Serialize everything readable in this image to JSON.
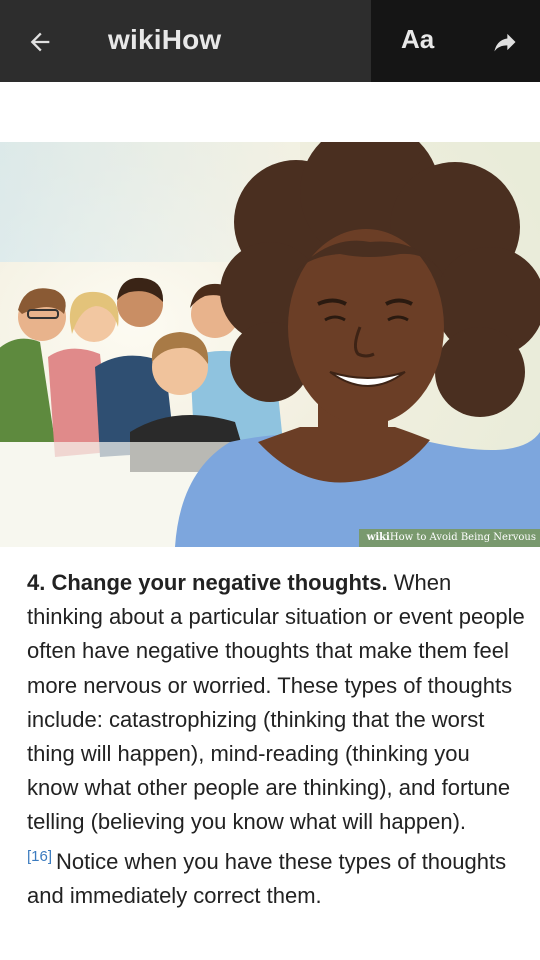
{
  "toolbar": {
    "title": "wikiHow",
    "font_label": "Aa",
    "icons": {
      "back": "arrow-left-icon",
      "share": "share-arrow-icon"
    }
  },
  "image": {
    "watermark_prefix": "wiki",
    "watermark_text": "How to Avoid Being Nervous"
  },
  "article": {
    "step_title": "4. Change your negative thoughts.",
    "text_part1": " When thinking about a particular situation or event people often have negative thoughts that make them feel more nervous or worried. These types of thoughts include: catastrophizing (thinking that the worst thing will happen), mind-reading (thinking you know what other people are thinking), and fortune telling (believing you know what will happen).",
    "reference": "[16]",
    "text_part2": "Notice when you have these types of thoughts and immediately correct them."
  },
  "colors": {
    "toolbar_left": "#2d2d2d",
    "toolbar_right": "#151515",
    "link_blue": "#3b7bbf"
  }
}
